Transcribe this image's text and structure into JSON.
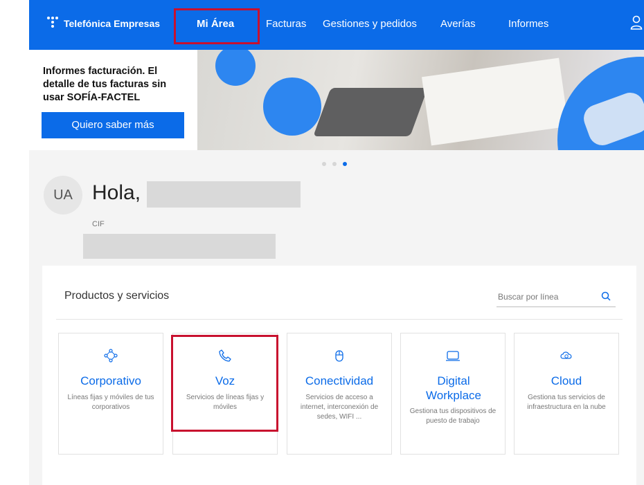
{
  "nav": {
    "brand": "Telefónica Empresas",
    "items": [
      {
        "label": "Mi Área",
        "active": true
      },
      {
        "label": "Facturas"
      },
      {
        "label": "Gestiones y pedidos"
      },
      {
        "label": "Averías"
      },
      {
        "label": "Informes"
      }
    ],
    "user_icon": "user-icon"
  },
  "banner": {
    "text": "Informes facturación. El detalle de tus facturas sin usar SOFÍA-FACTEL",
    "button_label": "Quiero saber más",
    "slides": 3,
    "active_slide": 3
  },
  "greeting": {
    "avatar_initials": "UA",
    "hello": "Hola,",
    "cif_label": "CIF"
  },
  "products": {
    "title": "Productos y servicios",
    "search_placeholder": "Buscar por línea",
    "cards": [
      {
        "icon": "network-icon",
        "title": "Corporativo",
        "description": "Líneas fijas y móviles de tus corporativos"
      },
      {
        "icon": "phone-icon",
        "title": "Voz",
        "description": "Servicios de líneas fijas y móviles"
      },
      {
        "icon": "mouse-icon",
        "title": "Conectividad",
        "description": "Servicios de acceso a internet, interconexión de sedes, WIFI ..."
      },
      {
        "icon": "laptop-icon",
        "title": "Digital Workplace",
        "description": "Gestiona tus dispositivos de puesto de trabajo"
      },
      {
        "icon": "cloud-icon",
        "title": "Cloud",
        "description": "Gestiona tus servicios de infraestructura en la nube"
      }
    ]
  },
  "colors": {
    "brand": "#0b6be8",
    "highlight": "#c8102e"
  }
}
